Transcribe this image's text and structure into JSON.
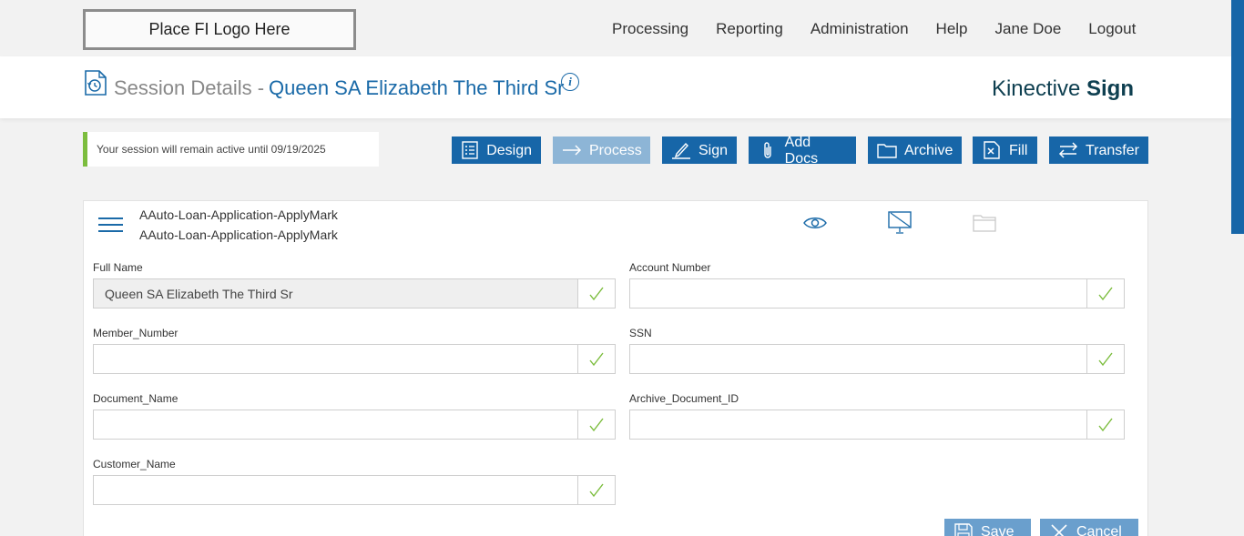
{
  "logo": {
    "text": "Place FI Logo Here"
  },
  "nav": [
    "Processing",
    "Reporting",
    "Administration",
    "Help",
    "Jane Doe",
    "Logout"
  ],
  "header": {
    "label": "Session Details -",
    "name": "Queen SA Elizabeth The Third Sr",
    "info_icon": "info-icon",
    "brand_light": "Kinective",
    "brand_bold": "Sign"
  },
  "session_note": "Your session will remain active until 09/19/2025",
  "colors": {
    "primary": "#1766a8",
    "disabled": "#8db5d6",
    "accent_green": "#7cbd3e",
    "brand_dark": "#0e3f50"
  },
  "toolbar": {
    "design": "Design",
    "process": "Process",
    "sign": "Sign",
    "add_docs": "Add Docs",
    "archive": "Archive",
    "fill": "Fill",
    "transfer": "Transfer"
  },
  "document": {
    "line1": "AAuto-Loan-Application-ApplyMark",
    "line2": "AAuto-Loan-Application-ApplyMark"
  },
  "fields": {
    "full_name": {
      "label": "Full Name",
      "value": "Queen SA Elizabeth The Third Sr"
    },
    "account_number": {
      "label": "Account Number",
      "value": ""
    },
    "member_number": {
      "label": "Member_Number",
      "value": ""
    },
    "ssn": {
      "label": "SSN",
      "value": ""
    },
    "document_name": {
      "label": "Document_Name",
      "value": ""
    },
    "archive_document_id": {
      "label": "Archive_Document_ID",
      "value": ""
    },
    "customer_name": {
      "label": "Customer_Name",
      "value": ""
    }
  },
  "actions": {
    "save": "Save",
    "cancel": "Cancel"
  }
}
